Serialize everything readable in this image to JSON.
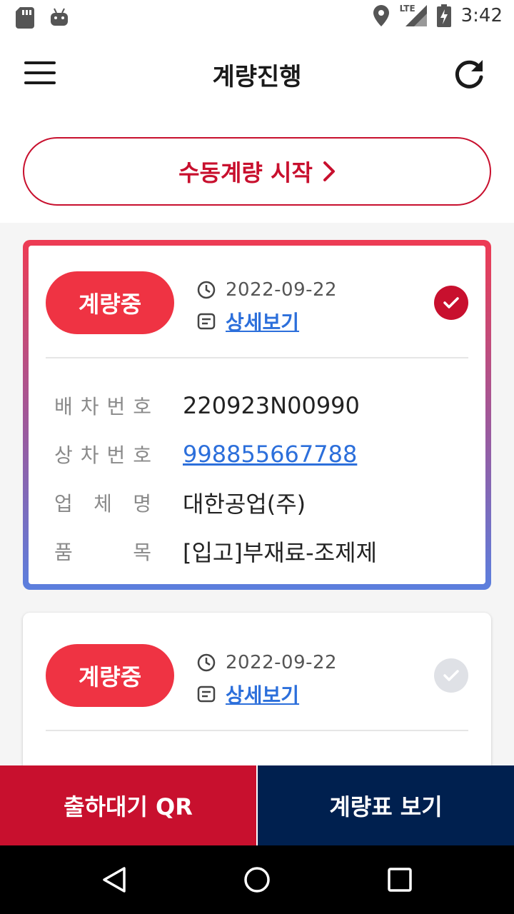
{
  "status_bar": {
    "time": "3:42",
    "network": "LTE"
  },
  "header": {
    "title": "계량진행"
  },
  "manual_button": {
    "label": "수동계량 시작"
  },
  "cards": [
    {
      "status": "계량중",
      "date": "2022-09-22",
      "detail_link": "상세보기",
      "selected": true,
      "fields": [
        {
          "label": [
            "배",
            "차",
            "번",
            "호"
          ],
          "value": "220923N00990",
          "link": false
        },
        {
          "label": [
            "상",
            "차",
            "번",
            "호"
          ],
          "value": "998855667788",
          "link": true
        },
        {
          "label": [
            "업",
            "체",
            "명"
          ],
          "value": "대한공업(주)",
          "link": false
        },
        {
          "label": [
            "품",
            "목"
          ],
          "value": "[입고]부재료-조제제",
          "link": false
        }
      ]
    },
    {
      "status": "계량중",
      "date": "2022-09-22",
      "detail_link": "상세보기",
      "selected": false
    }
  ],
  "bottom_buttons": {
    "qr": "출하대기 QR",
    "ticket": "계량표 보기"
  },
  "colors": {
    "accent": "#c8102e",
    "badge": "#ef3343",
    "navy": "#00204f",
    "link": "#2c6fdb"
  }
}
